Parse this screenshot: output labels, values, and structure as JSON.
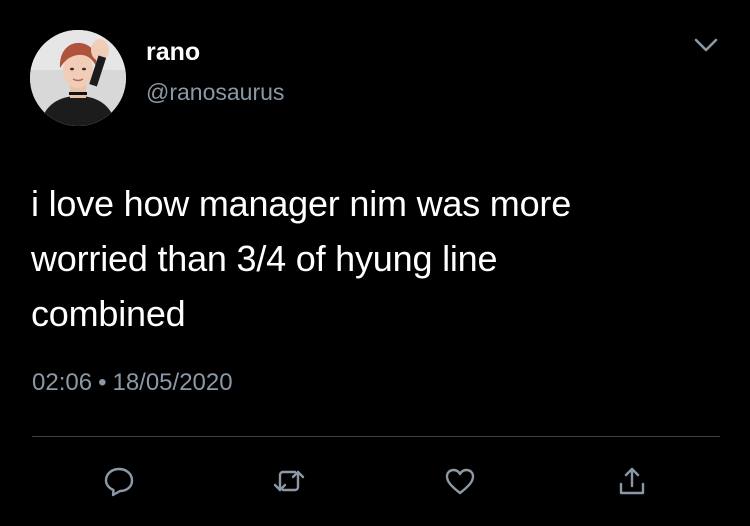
{
  "user": {
    "display_name": "rano",
    "handle": "@ranosaurus",
    "avatar_icon": "avatar-photo"
  },
  "tweet": {
    "text_lines": [
      "i love how manager nim was more",
      "worried than 3/4 of hyung line",
      "combined"
    ],
    "time": "02:06",
    "separator": "•",
    "date": "18/05/2020"
  },
  "actions": [
    {
      "icon": "reply-icon"
    },
    {
      "icon": "retweet-icon"
    },
    {
      "icon": "like-icon"
    },
    {
      "icon": "share-icon"
    }
  ],
  "menu": {
    "icon": "chevron-down-icon"
  },
  "colors": {
    "background": "#000000",
    "primary_text": "#ffffff",
    "secondary_text": "#8b98a5",
    "divider": "#38444d"
  }
}
